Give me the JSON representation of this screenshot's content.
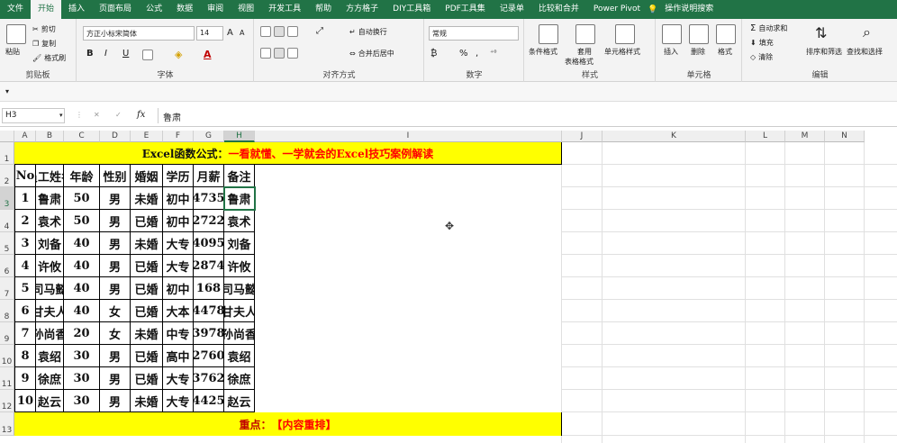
{
  "tabs": [
    "文件",
    "开始",
    "插入",
    "页面布局",
    "公式",
    "数据",
    "审阅",
    "视图",
    "开发工具",
    "帮助",
    "方方格子",
    "DIY工具箱",
    "PDF工具集",
    "记录单",
    "比较和合并",
    "Power Pivot",
    "操作说明搜索"
  ],
  "ribbon": {
    "clipboard": {
      "cut": "剪切",
      "copy": "复制",
      "painter": "格式刷",
      "paste": "粘贴",
      "label": "剪贴板"
    },
    "font": {
      "name": "方正小标宋简体",
      "size": "14",
      "grow": "A",
      "shrink": "A",
      "bold": "B",
      "italic": "I",
      "underline": "U",
      "label": "字体"
    },
    "align": {
      "wrap": "自动换行",
      "merge": "合并后居中",
      "label": "对齐方式"
    },
    "number": {
      "format": "常规",
      "pct": "%",
      "comma": ",",
      "label": "数字"
    },
    "styles": {
      "cond": "条件格式",
      "table1": "套用",
      "table2": "表格格式",
      "cellstyle": "单元格样式",
      "label": "样式"
    },
    "cells": {
      "insert": "插入",
      "delete": "删除",
      "format": "格式",
      "label": "单元格"
    },
    "edit": {
      "autosum": "自动求和",
      "fill": "填充",
      "clear": "清除",
      "sort": "排序和筛选",
      "find": "查找和选择",
      "label": "编辑"
    }
  },
  "namebox": "H3",
  "fx": "fx",
  "formula": "鲁肃",
  "columns": [
    "A",
    "B",
    "C",
    "D",
    "E",
    "F",
    "G",
    "H",
    "I",
    "J",
    "K",
    "L",
    "M",
    "N"
  ],
  "rows": [
    "1",
    "2",
    "3",
    "4",
    "5",
    "6",
    "7",
    "8",
    "9",
    "10",
    "11",
    "12",
    "13"
  ],
  "title": {
    "part1": "Excel函数公式：",
    "part2": "一看就懂、一学就会的Excel技巧案例解读"
  },
  "headers": [
    "No",
    "员工姓名",
    "年龄",
    "性别",
    "婚姻",
    "学历",
    "月薪",
    "备注"
  ],
  "data": [
    [
      "1",
      "鲁肃",
      "50",
      "男",
      "未婚",
      "初中",
      "4735",
      "鲁肃"
    ],
    [
      "2",
      "袁术",
      "50",
      "男",
      "已婚",
      "初中",
      "2722",
      "袁术"
    ],
    [
      "3",
      "刘备",
      "40",
      "男",
      "未婚",
      "大专",
      "4095",
      "刘备"
    ],
    [
      "4",
      "许攸",
      "40",
      "男",
      "已婚",
      "大专",
      "2874",
      "许攸"
    ],
    [
      "5",
      "司马懿",
      "40",
      "男",
      "已婚",
      "初中",
      "168",
      "司马懿"
    ],
    [
      "6",
      "甘夫人",
      "40",
      "女",
      "已婚",
      "大本",
      "4478",
      "甘夫人"
    ],
    [
      "7",
      "孙尚香",
      "20",
      "女",
      "未婚",
      "中专",
      "3978",
      "孙尚香"
    ],
    [
      "8",
      "袁绍",
      "30",
      "男",
      "已婚",
      "高中",
      "2760",
      "袁绍"
    ],
    [
      "9",
      "徐庶",
      "30",
      "男",
      "已婚",
      "大专",
      "3762",
      "徐庶"
    ],
    [
      "10",
      "赵云",
      "30",
      "男",
      "未婚",
      "大专",
      "4425",
      "赵云"
    ]
  ],
  "footer": {
    "part1": "重点：",
    "part2": "【内容重排】"
  },
  "colors": {
    "excel_green": "#217346",
    "yellow": "#ffff00",
    "red": "#ff0000"
  }
}
